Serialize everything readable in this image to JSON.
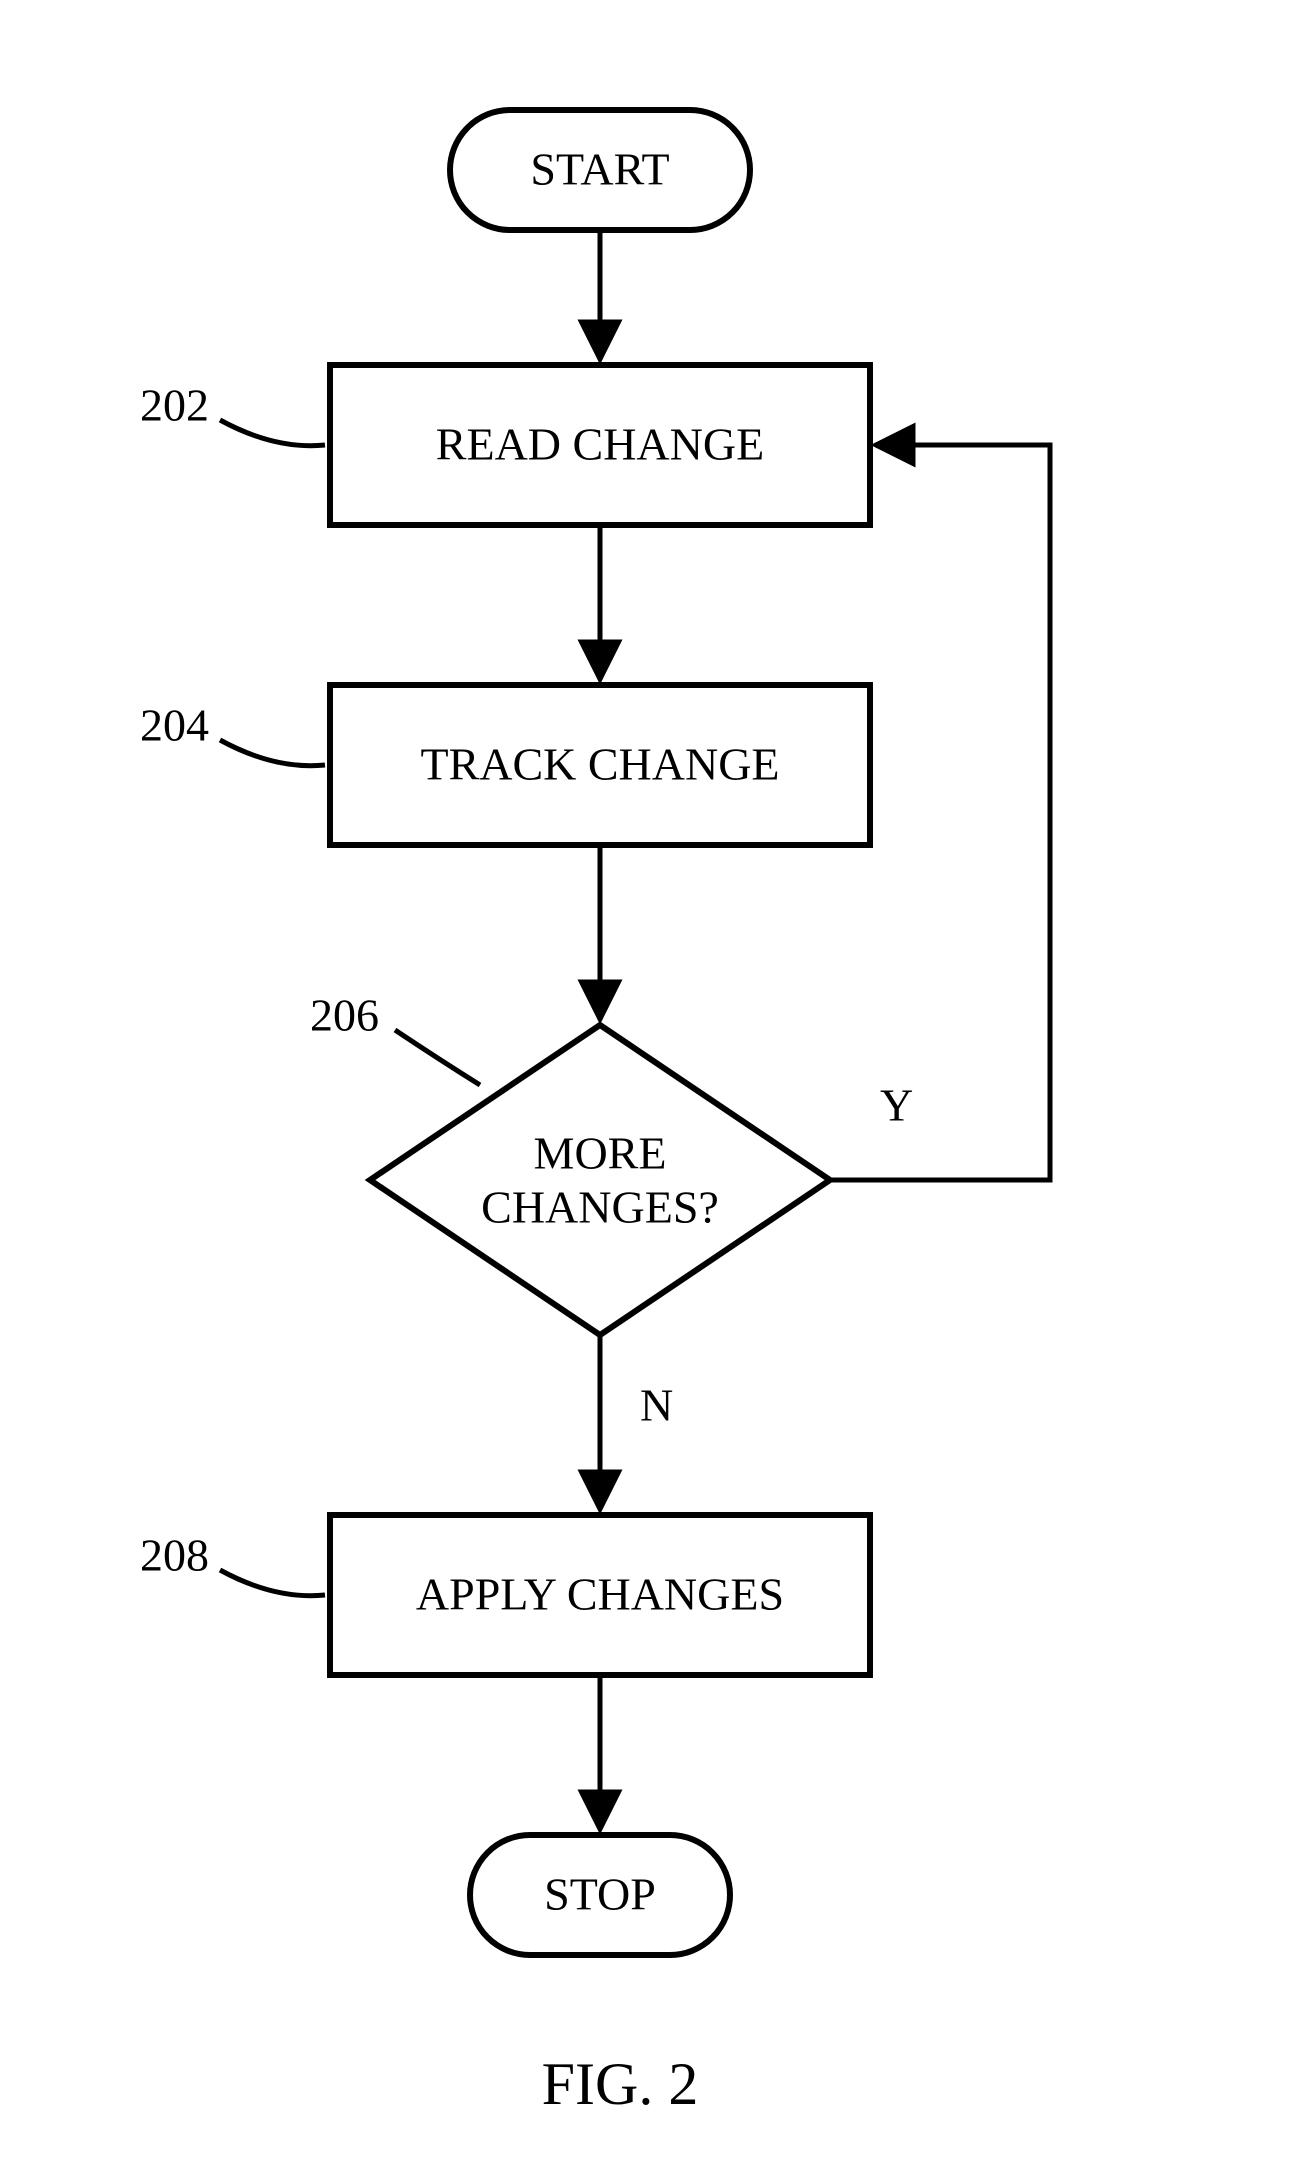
{
  "terminator": {
    "start": "START",
    "stop": "STOP"
  },
  "steps": {
    "read": {
      "ref": "202",
      "label": "READ CHANGE"
    },
    "track": {
      "ref": "204",
      "label": "TRACK CHANGE"
    },
    "decision": {
      "ref": "206",
      "line1": "MORE",
      "line2": "CHANGES?",
      "yes": "Y",
      "no": "N"
    },
    "apply": {
      "ref": "208",
      "label": "APPLY CHANGES"
    }
  },
  "caption": "FIG. 2"
}
